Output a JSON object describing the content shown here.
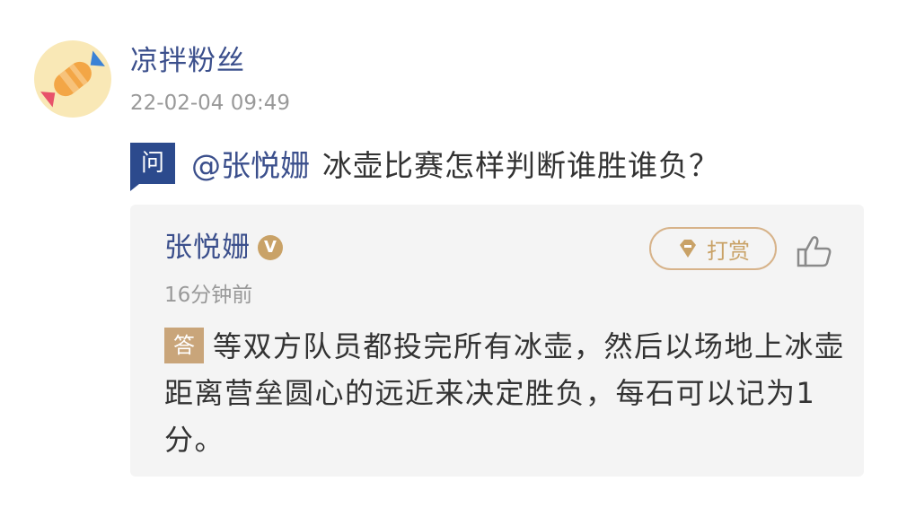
{
  "question_post": {
    "avatar": {
      "icon": "candy-icon",
      "bg_color": "#f9e8b6"
    },
    "username": "凉拌粉丝",
    "timestamp": "22-02-04 09:49",
    "question_badge": "问",
    "mention": "@张悦姗",
    "question_text": "冰壶比赛怎样判断谁胜谁负？"
  },
  "answer": {
    "answerer_name": "张悦姗",
    "verified_badge": "V",
    "time_ago": "16分钟前",
    "tip_button_label": "打赏",
    "like_icon": "thumbs-up-icon",
    "answer_badge": "答",
    "answer_text": "等双方队员都投完所有冰壶，然后以场地上冰壶距离营垒圆心的远近来决定胜负，每石可以记为1分。"
  },
  "colors": {
    "link_blue": "#3b4f8c",
    "question_badge_bg": "#2c4a8d",
    "gold": "#c9a267",
    "muted_gray": "#999999",
    "card_bg": "#f4f4f4"
  }
}
